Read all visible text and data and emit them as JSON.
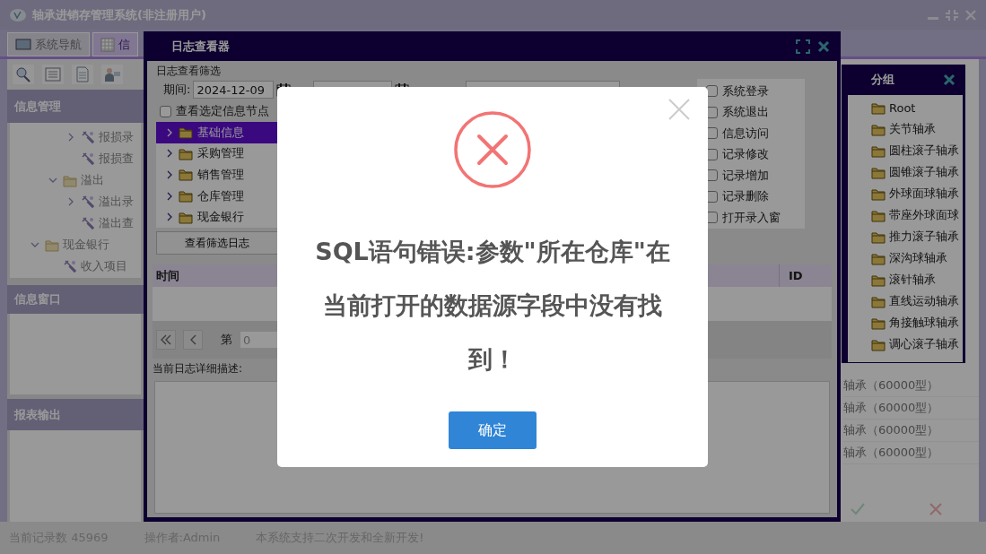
{
  "app": {
    "title": "轴承进销存管理系统(非注册用户)"
  },
  "tabs": [
    {
      "label": "系统导航",
      "selected": false
    },
    {
      "label": "信",
      "selected": true
    }
  ],
  "sidebar": {
    "sections": [
      {
        "title": "信息管理",
        "tree": [
          {
            "children": [
              {
                "children": [
                  {
                    "label": "报损录",
                    "kind": "entry",
                    "expanded": false
                  },
                  {
                    "label": "报损查",
                    "kind": "entry"
                  }
                ]
              },
              {
                "label": "溢出",
                "kind": "folder",
                "expanded": true,
                "children": [
                  {
                    "label": "溢出录",
                    "kind": "entry",
                    "expanded": false
                  },
                  {
                    "label": "溢出查",
                    "kind": "entry"
                  }
                ]
              }
            ]
          },
          {
            "label": "现金银行",
            "kind": "folder",
            "expanded": true,
            "children": [
              {
                "label": "收入项目",
                "kind": "entry"
              }
            ]
          }
        ]
      },
      {
        "title": "信息窗口"
      },
      {
        "title": "报表输出"
      }
    ]
  },
  "background_rows": [
    "轴承（60000型）",
    "轴承（60000型）",
    "轴承（60000型）",
    "轴承（60000型）"
  ],
  "status_bar": [
    "当前记录数 45969",
    "操作者:Admin",
    "本系统支持二次开发和全新开发!"
  ],
  "log_viewer": {
    "title": "日志查看器",
    "filter_label": "日志查看筛选",
    "period_label": "期间:",
    "start_date": "2024-12-09",
    "node_filter": {
      "label": "查看选定信息节点",
      "checked": false
    },
    "nodes": [
      {
        "label": "基础信息",
        "selected": true
      },
      {
        "label": "采购管理",
        "selected": false
      },
      {
        "label": "销售管理",
        "selected": false
      },
      {
        "label": "仓库管理",
        "selected": false
      },
      {
        "label": "现金银行",
        "selected": false
      }
    ],
    "filter_button": "查看筛选日志",
    "types": [
      {
        "label": "系统登录",
        "checked": false
      },
      {
        "label": "系统退出",
        "checked": false
      },
      {
        "label": "信息访问",
        "checked": false
      },
      {
        "label": "记录修改",
        "checked": false
      },
      {
        "label": "记录增加",
        "checked": false
      },
      {
        "label": "记录删除",
        "checked": false
      },
      {
        "label": "打开录入窗",
        "checked": false
      }
    ],
    "columns": [
      "时间",
      "ID"
    ],
    "pager": {
      "page_label": "第",
      "page": "0"
    },
    "detail_label": "当前日志详细描述:"
  },
  "group_window": {
    "title": "分组",
    "items": [
      "Root",
      "关节轴承",
      "圆柱滚子轴承",
      "圆锥滚子轴承",
      "外球面球轴承",
      "带座外球面球",
      "推力滚子轴承",
      "深沟球轴承",
      "滚针轴承",
      "直线运动轴承",
      "角接触球轴承",
      "调心滚子轴承"
    ]
  },
  "dialog": {
    "message": "SQL语句错误:参数\"所在仓库\"在当前打开的数据源字段中没有找到！",
    "ok_button": "确定"
  }
}
